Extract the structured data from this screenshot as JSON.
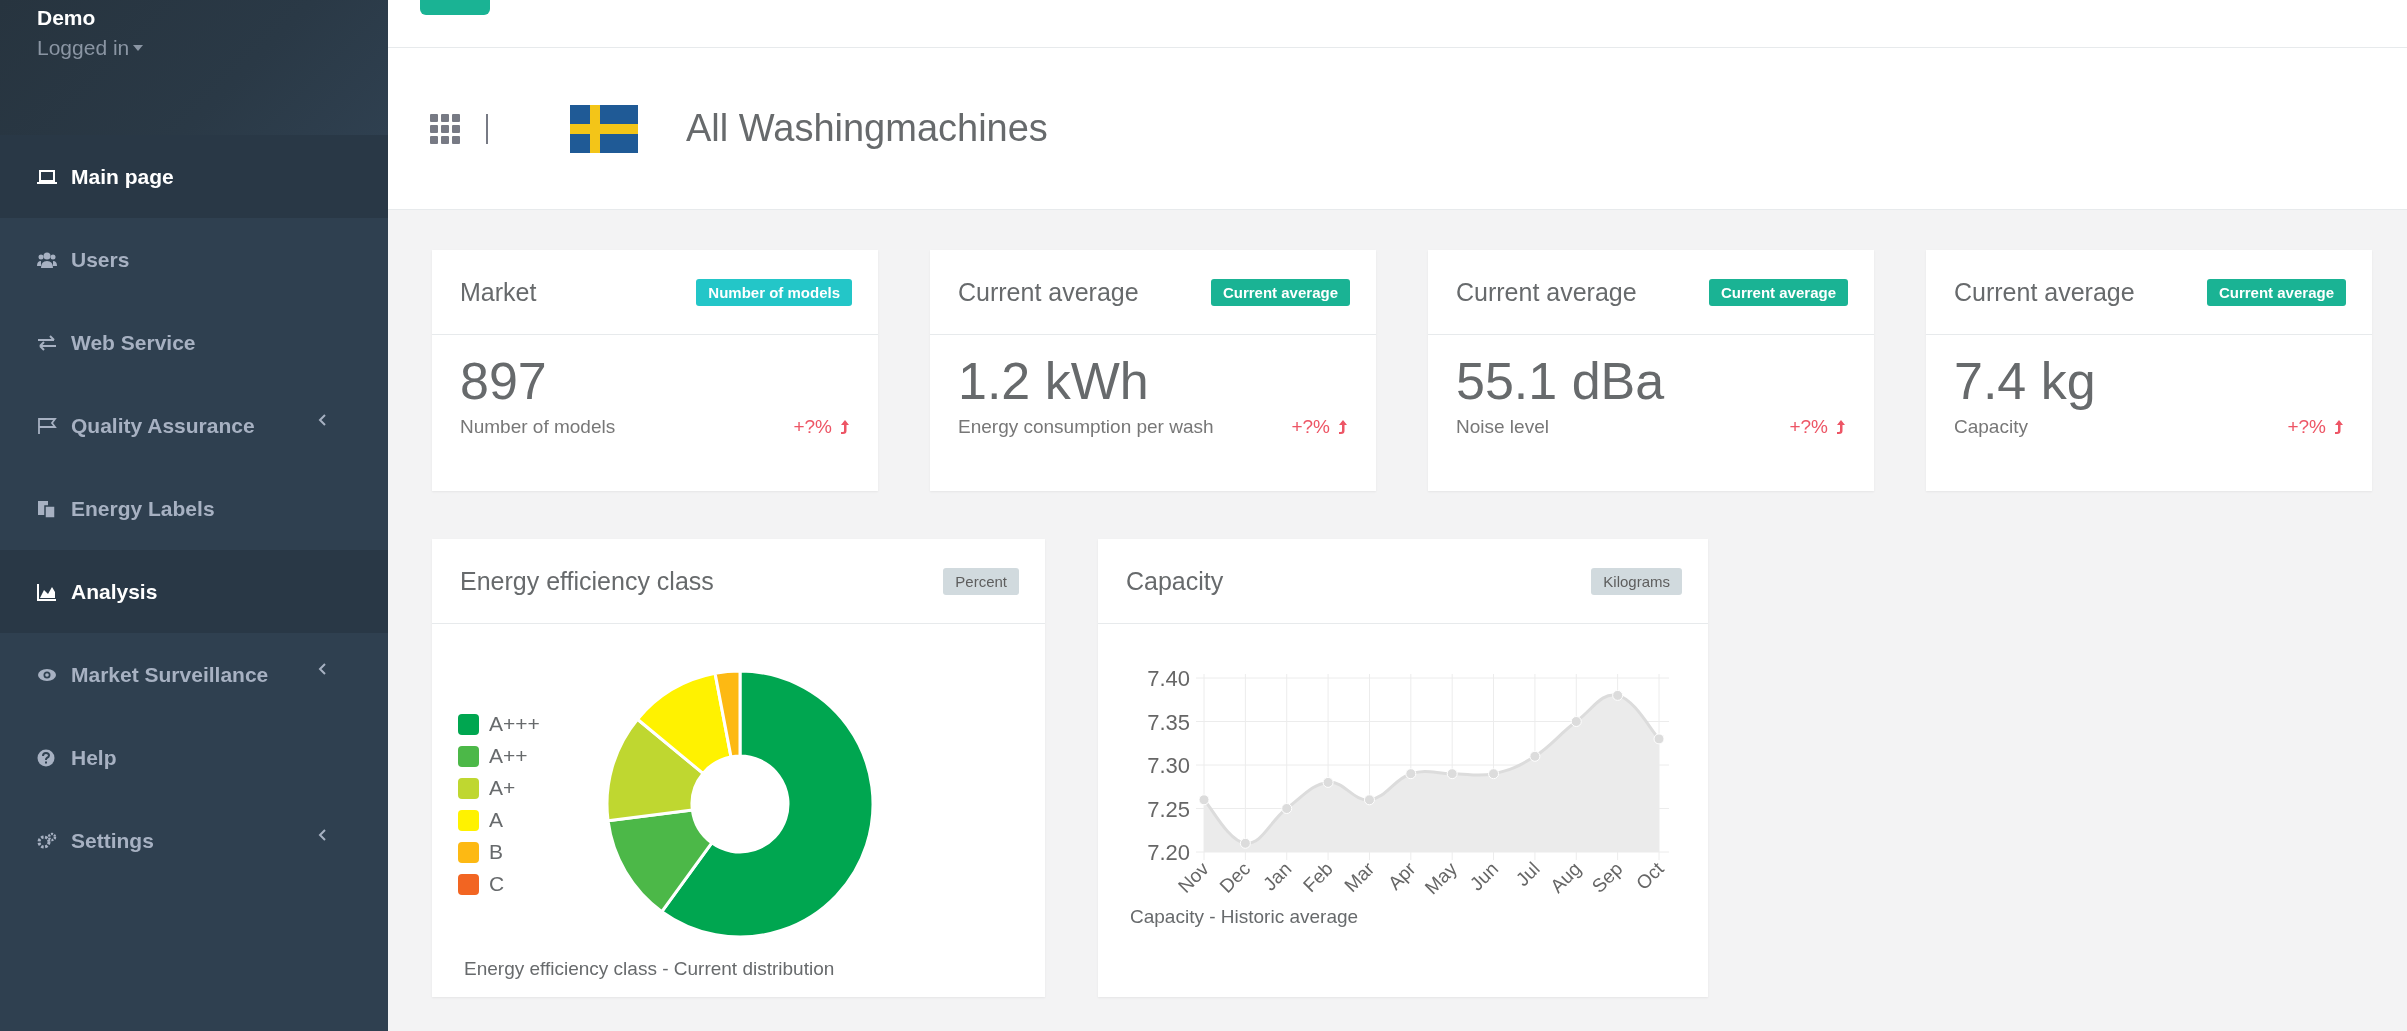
{
  "sidebar": {
    "user": {
      "name": "Demo",
      "status": "Logged in"
    },
    "items": [
      {
        "label": "Main page",
        "selected": true,
        "kind": "link"
      },
      {
        "label": "Users",
        "selected": false,
        "kind": "link"
      },
      {
        "label": "Web Service",
        "selected": false,
        "kind": "link"
      },
      {
        "label": "Quality Assurance",
        "selected": false,
        "kind": "submenu"
      },
      {
        "label": "Energy Labels",
        "selected": false,
        "kind": "link"
      },
      {
        "label": "Analysis",
        "selected": true,
        "kind": "link"
      },
      {
        "label": "Market Surveillance",
        "selected": false,
        "kind": "submenu"
      },
      {
        "label": "Help",
        "selected": false,
        "kind": "link"
      },
      {
        "label": "Settings",
        "selected": false,
        "kind": "submenu"
      }
    ]
  },
  "header": {
    "title": "All Washingmachines"
  },
  "stat_cards": [
    {
      "title": "Market",
      "badge": {
        "label": "Number of models",
        "color": "#23c6c8"
      },
      "value": "897",
      "caption": "Number of models",
      "change": "+?%"
    },
    {
      "title": "Current average",
      "badge": {
        "label": "Current average",
        "color": "#1ab394"
      },
      "value": "1.2 kWh",
      "caption": "Energy consumption per wash",
      "change": "+?%"
    },
    {
      "title": "Current average",
      "badge": {
        "label": "Current average",
        "color": "#1ab394"
      },
      "value": "55.1 dBa",
      "caption": "Noise level",
      "change": "+?%"
    },
    {
      "title": "Current average",
      "badge": {
        "label": "Current average",
        "color": "#1ab394"
      },
      "value": "7.4 kg",
      "caption": "Capacity",
      "change": "+?%"
    }
  ],
  "donut_card": {
    "title": "Energy efficiency class",
    "badge": "Percent",
    "caption": "Energy efficiency class - Current distribution",
    "legend": [
      {
        "color": "#00a650"
      },
      {
        "color": "#4cb848"
      },
      {
        "color": "#bfd730"
      },
      {
        "color": "#fff200"
      },
      {
        "color": "#fdb913"
      },
      {
        "color": "#f26522"
      }
    ],
    "chart_data": {
      "type": "donut",
      "categories": [
        "A+++",
        "A++",
        "A+",
        "A",
        "B",
        "C"
      ],
      "values": [
        60,
        13,
        13,
        11,
        3,
        0
      ],
      "legend": true
    }
  },
  "line_card": {
    "title": "Capacity",
    "badge": "Kilograms",
    "caption": "Capacity - Historic average",
    "chart_data": {
      "type": "area",
      "categories": [
        "Nov",
        "Dec",
        "Jan",
        "Feb",
        "Mar",
        "Apr",
        "May",
        "Jun",
        "Jul",
        "Aug",
        "Sep",
        "Oct"
      ],
      "grid": true,
      "series": [
        {
          "values": [
            7.26,
            7.21,
            7.25,
            7.28,
            7.26,
            7.29,
            7.29,
            7.29,
            7.31,
            7.35,
            7.38,
            7.33
          ]
        }
      ],
      "ylim": [
        7.2,
        7.4
      ],
      "yticks": [
        {
          "value": 7.2,
          "label": "7.20"
        },
        {
          "value": 7.25,
          "label": "7.25"
        },
        {
          "value": 7.3,
          "label": "7.30"
        },
        {
          "value": 7.35,
          "label": "7.35"
        },
        {
          "value": 7.4,
          "label": "7.40"
        }
      ]
    }
  }
}
